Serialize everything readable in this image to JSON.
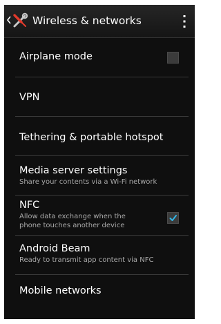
{
  "actionbar": {
    "title": "Wireless & networks",
    "back_icon": "chevron-left-icon",
    "app_icon": "wrench-screwdriver-icon",
    "overflow_icon": "overflow-menu-icon"
  },
  "colors": {
    "accent": "#33b5e5",
    "background": "#0f0f0f",
    "summary_text": "#a8a8a8"
  },
  "settings": {
    "items": [
      {
        "label": "Airplane mode",
        "checkbox": true,
        "checked": false
      },
      {
        "label": "VPN"
      },
      {
        "label": "Tethering & portable hotspot"
      },
      {
        "label": "Media server settings",
        "summary": "Share your contents via a Wi-Fi network"
      },
      {
        "label": "NFC",
        "summary_line1": "Allow data exchange when the",
        "summary_line2": "phone touches another device",
        "checkbox": true,
        "checked": true
      },
      {
        "label": "Android Beam",
        "summary": "Ready to transmit app content via NFC"
      },
      {
        "label": "Mobile networks"
      }
    ]
  }
}
